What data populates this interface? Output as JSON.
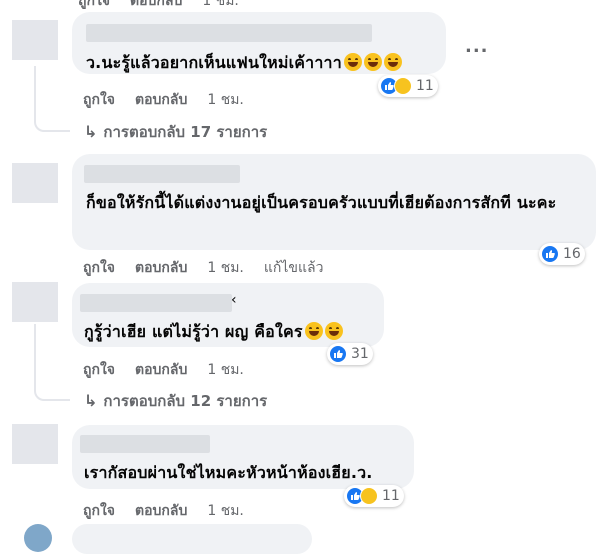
{
  "header": {
    "like_label": "ถูกใจ",
    "reply_label": "ตอบกลับ",
    "time": "1 ชม."
  },
  "comments": [
    {
      "text": "ว.นะรู้แล้วอยากเห็นแฟนใหม่เค้าาาา",
      "reactions": "11",
      "like_label": "ถูกใจ",
      "reply_label": "ตอบกลับ",
      "time": "1 ชม.",
      "replies": "การตอบกลับ 17 รายการ",
      "more": "..."
    },
    {
      "text": "ก็ขอให้รักนี้ได้แต่งงานอยู่เป็นครอบครัวแบบที่เฮียต้องการสักที นะคะ",
      "reactions": "16",
      "like_label": "ถูกใจ",
      "reply_label": "ตอบกลับ",
      "time": "1 ชม.",
      "edited": "แก้ไขแล้ว"
    },
    {
      "text": "กูรู้ว่าเฮีย แต่ไม่รู้ว่า ผญ คือใคร",
      "name_suffix": "‹",
      "reactions": "31",
      "like_label": "ถูกใจ",
      "reply_label": "ตอบกลับ",
      "time": "1 ชม.",
      "replies": "การตอบกลับ 12 รายการ"
    },
    {
      "text": "เรากัสอบผ่านใช่ไหมคะหัวหน้าห้องเฮีย.ว.",
      "reactions": "11",
      "like_label": "ถูกใจ",
      "reply_label": "ตอบกลับ",
      "time": "1 ชม."
    }
  ]
}
